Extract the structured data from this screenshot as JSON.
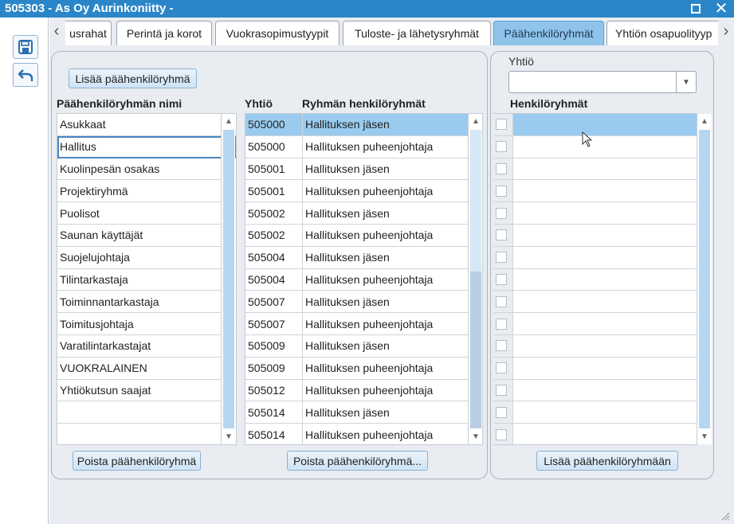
{
  "window": {
    "title": "505303 - As Oy Aurinkoniitty -"
  },
  "toolbar": {
    "icons": [
      "save-icon",
      "undo-icon"
    ]
  },
  "tabs": {
    "items": [
      {
        "label": "usrahat"
      },
      {
        "label": "Perintä ja korot"
      },
      {
        "label": "Vuokrasopimustyypit"
      },
      {
        "label": "Tuloste- ja lähetysryhmät"
      },
      {
        "label": "Päähenkilöryhmät"
      },
      {
        "label": "Yhtiön osapuolityyp"
      }
    ],
    "active_index": 4
  },
  "left_panel": {
    "add_button": "Lisää päähenkilöryhmä",
    "groups_header": "Päähenkilöryhmän nimi",
    "groups": [
      "Asukkaat",
      "Hallitus",
      "Kuolinpesän osakas",
      "Projektiryhmä",
      "Puolisot",
      "Saunan käyttäjät",
      "Suojelujohtaja",
      "Tilintarkastaja",
      "Toiminnantarkastaja",
      "Toimitusjohtaja",
      "Varatilintarkastajat",
      "VUOKRALAINEN",
      "Yhtiökutsun saajat"
    ],
    "selected_group": "Hallitus",
    "company_header": "Yhtiö",
    "member_groups_header": "Ryhmän henkilöryhmät",
    "member_rows": [
      {
        "company": "505000",
        "group": "Hallituksen jäsen"
      },
      {
        "company": "505000",
        "group": "Hallituksen puheenjohtaja"
      },
      {
        "company": "505001",
        "group": "Hallituksen jäsen"
      },
      {
        "company": "505001",
        "group": "Hallituksen puheenjohtaja"
      },
      {
        "company": "505002",
        "group": "Hallituksen jäsen"
      },
      {
        "company": "505002",
        "group": "Hallituksen puheenjohtaja"
      },
      {
        "company": "505004",
        "group": "Hallituksen jäsen"
      },
      {
        "company": "505004",
        "group": "Hallituksen puheenjohtaja"
      },
      {
        "company": "505007",
        "group": "Hallituksen jäsen"
      },
      {
        "company": "505007",
        "group": "Hallituksen puheenjohtaja"
      },
      {
        "company": "505009",
        "group": "Hallituksen jäsen"
      },
      {
        "company": "505009",
        "group": "Hallituksen puheenjohtaja"
      },
      {
        "company": "505012",
        "group": "Hallituksen puheenjohtaja"
      },
      {
        "company": "505014",
        "group": "Hallituksen jäsen"
      },
      {
        "company": "505014",
        "group": "Hallituksen puheenjohtaja"
      }
    ],
    "delete_group_button": "Poista päähenkilöryhmä",
    "delete_member_button": "Poista päähenkilöryhmä..."
  },
  "right_panel": {
    "company_label": "Yhtiö",
    "company_value": "",
    "person_groups_header": "Henkilöryhmät",
    "add_to_group_button": "Lisää päähenkilöryhmään"
  },
  "colors": {
    "titlebar": "#2a86c8",
    "selection": "#9acbef",
    "active_tab": "#8fc3ea",
    "panel_bg": "#e9ecf0"
  }
}
